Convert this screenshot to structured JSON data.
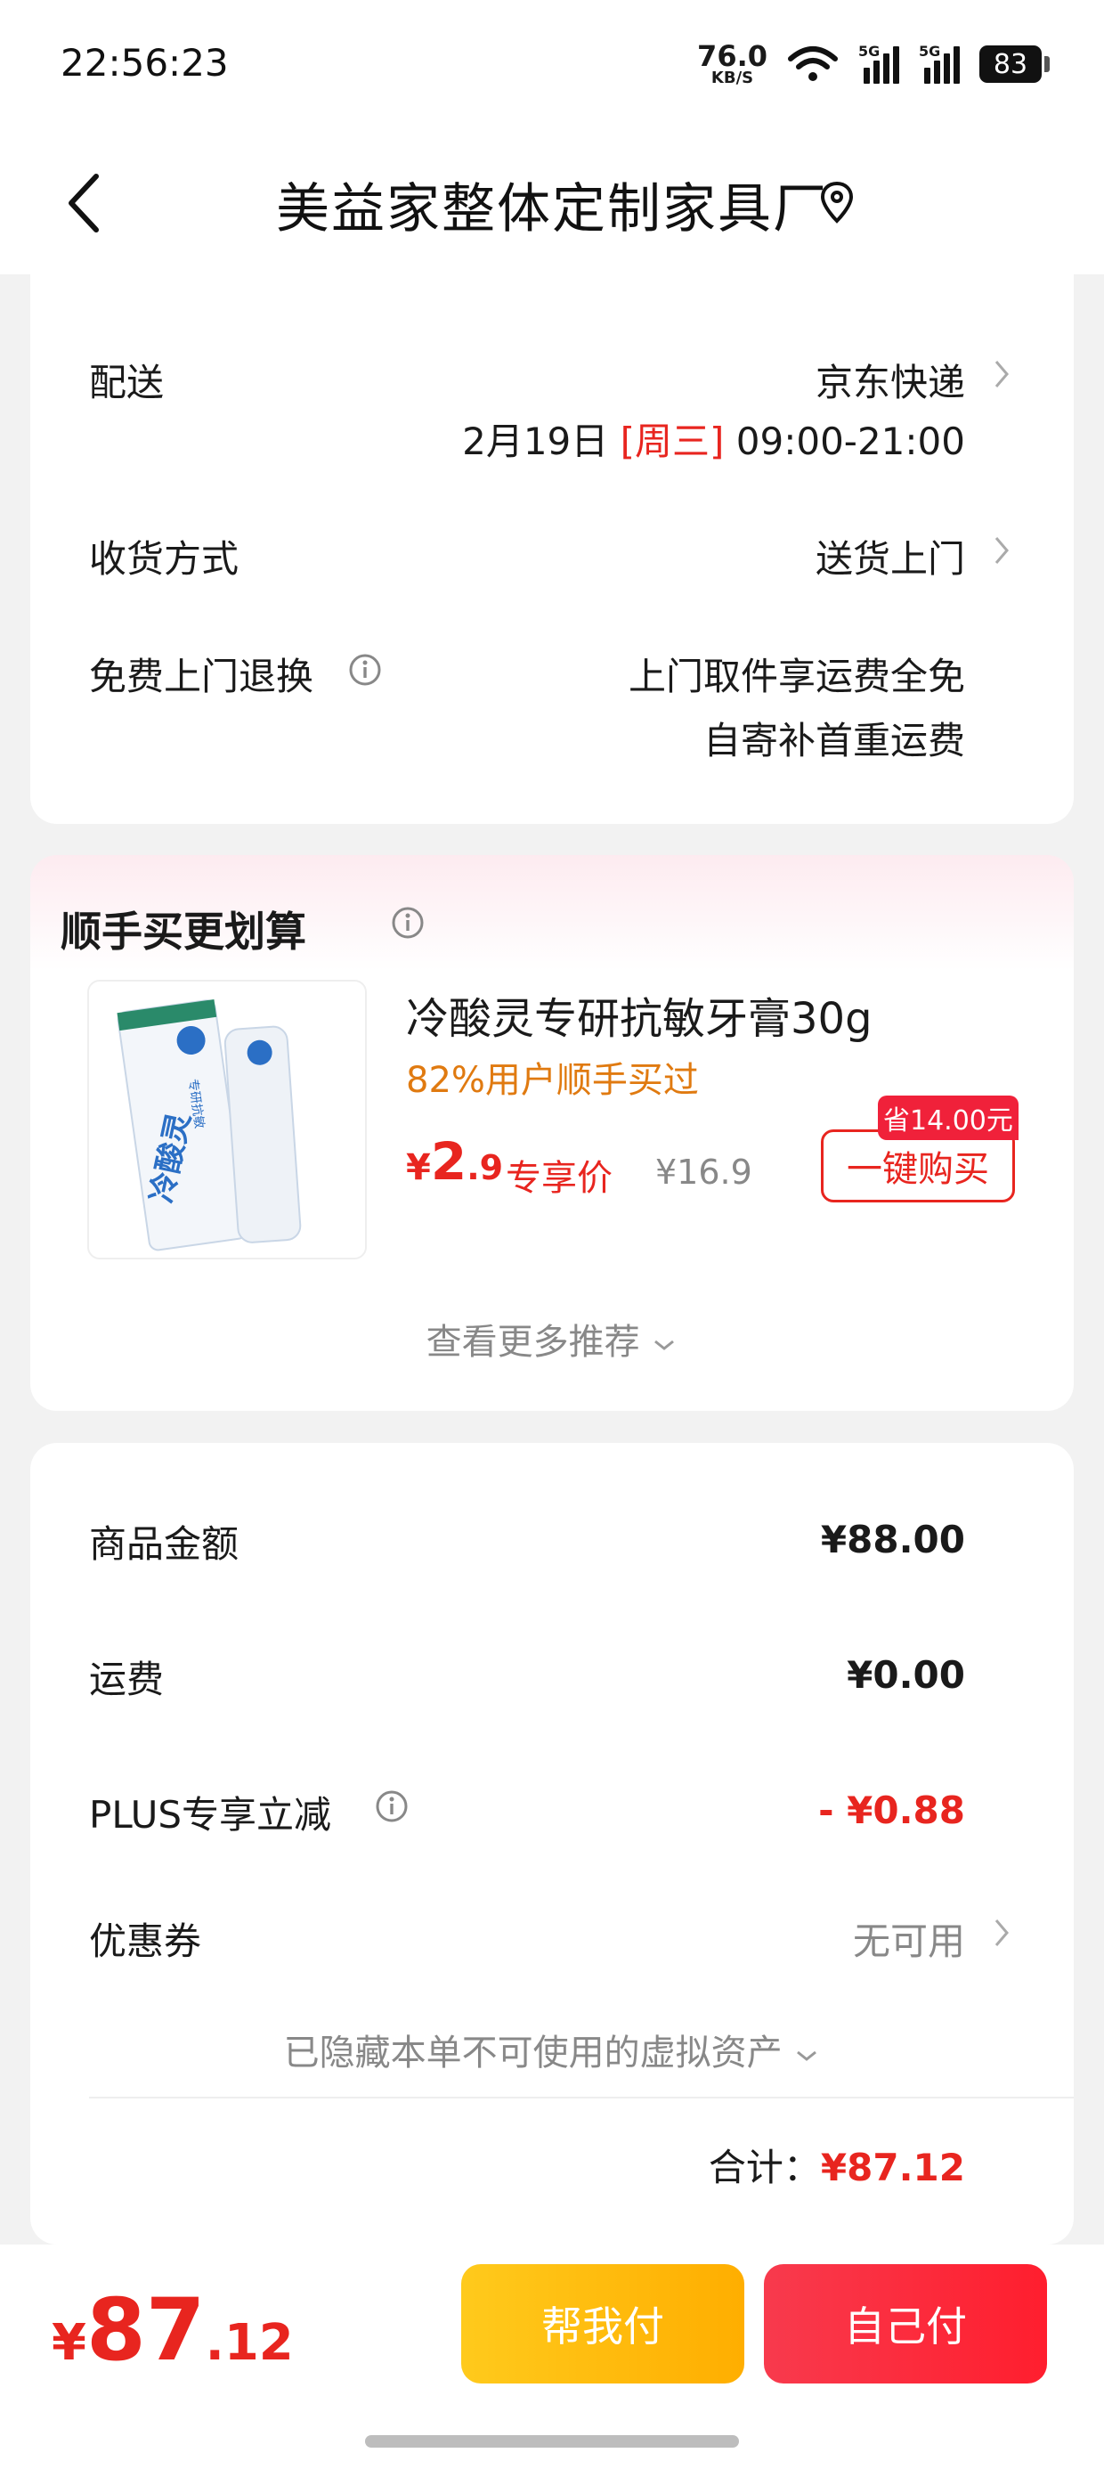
{
  "status_bar": {
    "time": "22:56:23",
    "net_speed_value": "76.0",
    "net_speed_unit": "KB/S",
    "signal_1_label": "5G",
    "signal_2_label": "5G",
    "battery": "83"
  },
  "header": {
    "title": "美益家整体定制家具厂"
  },
  "delivery": {
    "label": "配送",
    "carrier": "京东快递",
    "date": "2月19日",
    "weekday": "[周三]",
    "time_window": "09:00-21:00",
    "receive_method_label": "收货方式",
    "receive_method_value": "送货上门",
    "return_label": "免费上门退换",
    "return_line1": "上门取件享运费全免",
    "return_line2": "自寄补首重运费"
  },
  "upsell": {
    "title": "顺手买更划算",
    "product_name": "冷酸灵专研抗敏牙膏30g",
    "product_sub": "82%用户顺手买过",
    "price_yen": "¥",
    "price_int": "2",
    "price_dec": ".9",
    "price_tag": "专享价",
    "price_original": "¥16.9",
    "save_badge": "省14.00元",
    "buy_button": "一键购买",
    "more_recommend": "查看更多推荐",
    "package_brand": "冷酸灵",
    "package_sub": "专研抗敏"
  },
  "amounts": {
    "goods_label": "商品金额",
    "goods_value": "¥88.00",
    "shipping_label": "运费",
    "shipping_value": "¥0.00",
    "plus_label": "PLUS专享立减",
    "plus_value": "- ¥0.88",
    "coupon_label": "优惠券",
    "coupon_value": "无可用",
    "hidden_assets": "已隐藏本单不可使用的虚拟资产",
    "total_label": "合计：",
    "total_value": "¥87.12"
  },
  "footer": {
    "price_yen": "¥",
    "price_int": "87",
    "price_dec": ".12",
    "help_pay": "帮我付",
    "self_pay": "自己付"
  },
  "colors": {
    "accent_red": "#e8251f",
    "orange": "#e07a10",
    "help_pay_yellow": "#ffb800",
    "self_pay_red": "#ff2a3c"
  }
}
